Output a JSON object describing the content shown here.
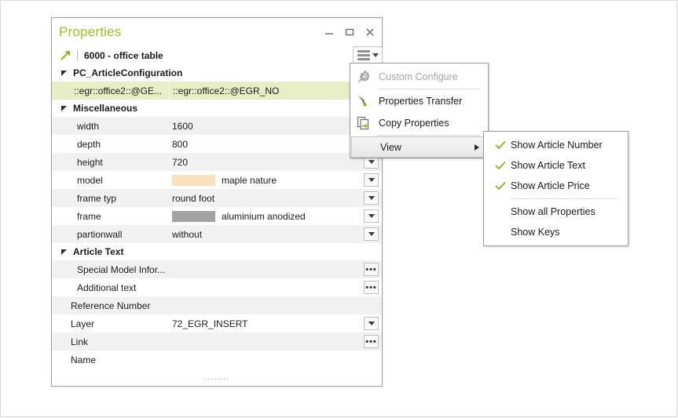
{
  "window": {
    "title": "Properties",
    "controls": [
      {
        "name": "minimize",
        "glyph": "minimize-icon"
      },
      {
        "name": "maximize",
        "glyph": "maximize-icon"
      },
      {
        "name": "close",
        "glyph": "close-icon"
      }
    ],
    "article_header": {
      "icon": "green-arrow-icon",
      "label": "6000 - office table"
    },
    "menu_button": {
      "icon": "hamburger-icon",
      "caret": "caret-down-icon"
    },
    "resize_grip": "........"
  },
  "colors": {
    "title_green": "#9cc222",
    "selection_green": "#e7edc4",
    "check_green": "#8cb820",
    "stripe_gray": "#f1f1f1",
    "swatch_maple": "#f6e2bd",
    "swatch_aluminium": "#a3a3a3"
  },
  "grid": {
    "rows": [
      {
        "kind": "group",
        "label": "PC_ArticleConfiguration"
      },
      {
        "kind": "prop",
        "name": "::egr::office2::@GE...",
        "value": "::egr::office2::@EGR_NO",
        "selected": true,
        "editor": "none",
        "indent": 1
      },
      {
        "kind": "group",
        "label": "Miscellaneous"
      },
      {
        "kind": "prop",
        "name": "width",
        "value": "1600",
        "stripe": true,
        "editor": "none",
        "indent": 1
      },
      {
        "kind": "prop",
        "name": "depth",
        "value": "800",
        "stripe": false,
        "editor": "none",
        "indent": 1
      },
      {
        "kind": "prop",
        "name": "height",
        "value": "720",
        "stripe": true,
        "editor": "dropdown",
        "indent": 1
      },
      {
        "kind": "prop",
        "name": "model",
        "value": "maple nature",
        "stripe": false,
        "editor": "dropdown",
        "indent": 1,
        "swatch": "#f6e2bd"
      },
      {
        "kind": "prop",
        "name": "frame typ",
        "value": "round foot",
        "stripe": true,
        "editor": "dropdown",
        "indent": 1
      },
      {
        "kind": "prop",
        "name": "frame",
        "value": "aluminium anodized",
        "stripe": false,
        "editor": "dropdown",
        "indent": 1,
        "swatch": "#a3a3a3"
      },
      {
        "kind": "prop",
        "name": "partionwall",
        "value": "without",
        "stripe": true,
        "editor": "dropdown",
        "indent": 1
      },
      {
        "kind": "group",
        "label": "Article Text"
      },
      {
        "kind": "prop",
        "name": "Special Model Infor...",
        "value": "",
        "stripe": true,
        "editor": "ellipsis",
        "indent": 1
      },
      {
        "kind": "prop",
        "name": "Additional text",
        "value": "",
        "stripe": false,
        "editor": "ellipsis",
        "indent": 1
      },
      {
        "kind": "prop",
        "name": "Reference Number",
        "value": "",
        "stripe": true,
        "editor": "none",
        "indent": 0
      },
      {
        "kind": "prop",
        "name": "Layer",
        "value": "72_EGR_INSERT",
        "stripe": false,
        "editor": "dropdown",
        "indent": 0
      },
      {
        "kind": "prop",
        "name": "Link",
        "value": "",
        "stripe": true,
        "editor": "ellipsis",
        "indent": 0
      },
      {
        "kind": "prop",
        "name": "Name",
        "value": "",
        "stripe": false,
        "editor": "none",
        "indent": 0
      }
    ]
  },
  "context_menu": {
    "items": [
      {
        "label": "Custom Configure",
        "icon": "gear-icon",
        "disabled": true,
        "separator_after": true
      },
      {
        "label": "Properties Transfer",
        "icon": "brush-icon",
        "disabled": false,
        "separator_after": false
      },
      {
        "label": "Copy Properties",
        "icon": "copy-icon",
        "disabled": false,
        "separator_after": true
      },
      {
        "label": "View",
        "icon": "none",
        "disabled": false,
        "highlight": true,
        "has_submenu": true
      }
    ]
  },
  "view_submenu": {
    "items": [
      {
        "label": "Show Article Number",
        "checked": true
      },
      {
        "label": "Show Article Text",
        "checked": true
      },
      {
        "label": "Show Article Price",
        "checked": true,
        "separator_after": true
      },
      {
        "label": "Show all Properties",
        "checked": false
      },
      {
        "label": "Show Keys",
        "checked": false
      }
    ]
  }
}
